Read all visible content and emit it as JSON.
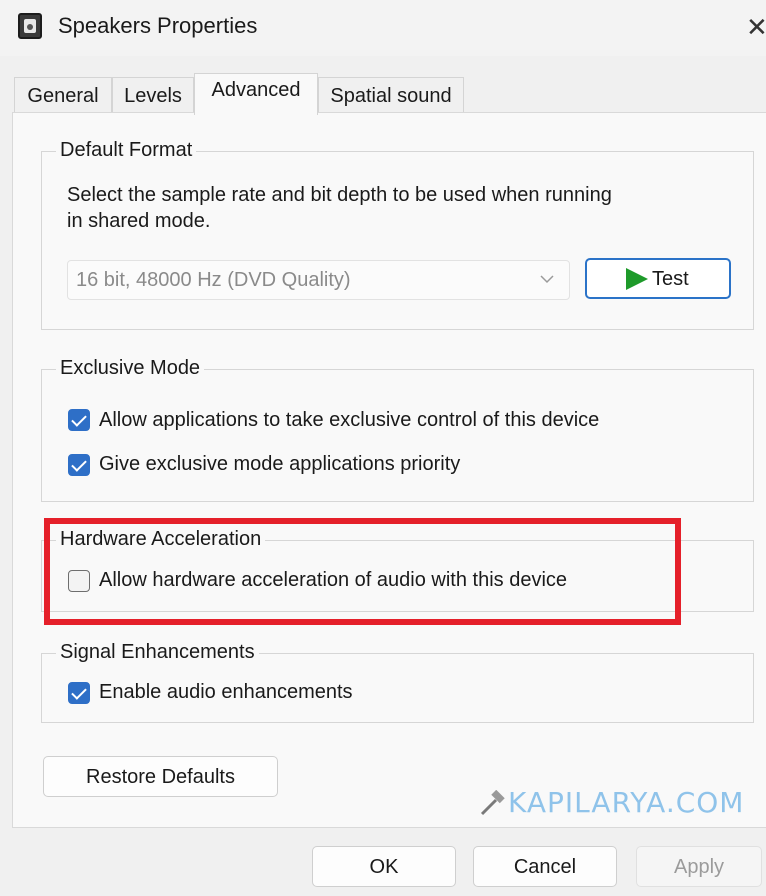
{
  "window": {
    "title": "Speakers Properties",
    "close_glyph": "✕",
    "icon": "speaker-app-icon"
  },
  "tabs": [
    {
      "label": "General",
      "active": false
    },
    {
      "label": "Levels",
      "active": false
    },
    {
      "label": "Advanced",
      "active": true
    },
    {
      "label": "Spatial sound",
      "active": false
    }
  ],
  "default_format": {
    "title": "Default Format",
    "description_line1": "Select the sample rate and bit depth to be used when running",
    "description_line2": "in shared mode.",
    "selected_value": "16 bit, 48000 Hz (DVD Quality)",
    "test_label": "Test"
  },
  "exclusive_mode": {
    "title": "Exclusive Mode",
    "options": [
      {
        "label": "Allow applications to take exclusive control of this device",
        "checked": true
      },
      {
        "label": "Give exclusive mode applications priority",
        "checked": true
      }
    ]
  },
  "hardware_acceleration": {
    "title": "Hardware Acceleration",
    "option": {
      "label": "Allow hardware acceleration of audio with this device",
      "checked": false
    },
    "highlight_color": "#e5202a"
  },
  "signal_enhancements": {
    "title": "Signal Enhancements",
    "option": {
      "label": "Enable audio enhancements",
      "checked": true
    }
  },
  "buttons": {
    "restore_defaults": "Restore Defaults",
    "ok": "OK",
    "cancel": "Cancel",
    "apply": "Apply"
  },
  "watermark": {
    "text": "KAPILARYA.COM",
    "color": "#8fc3ea"
  },
  "colors": {
    "checkbox_accent": "#2e6fc7",
    "test_border": "#2b73c8",
    "play_icon": "#1e9a2a"
  }
}
